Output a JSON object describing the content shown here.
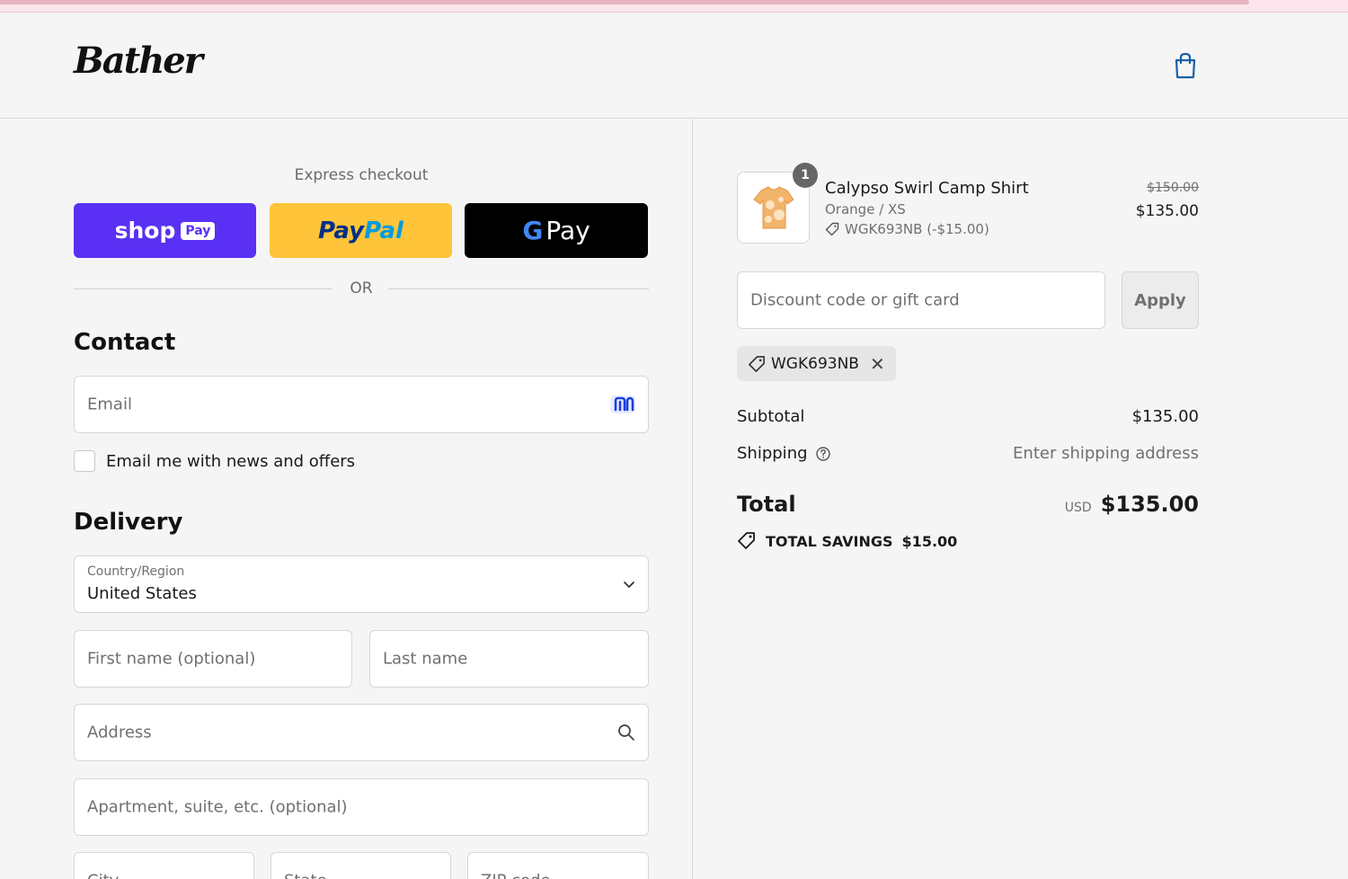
{
  "brand": {
    "logo_text": "Bather"
  },
  "icons": {
    "cart": "shopping-bag-icon",
    "shop_pay_email": "shop-pay-icon",
    "chevron": "chevron-down-icon",
    "search": "search-icon",
    "discount_tag": "tag-icon",
    "remove": "close-icon",
    "help": "question-icon"
  },
  "express": {
    "label": "Express checkout",
    "shop_pay": {
      "text": "shop",
      "badge": "Pay"
    },
    "paypal": {
      "part1": "Pay",
      "part2": "Pal"
    },
    "gpay": {
      "g": "G",
      "text": "Pay"
    },
    "or": "OR"
  },
  "contact": {
    "title": "Contact",
    "email_placeholder": "Email",
    "newsletter_label": "Email me with news and offers"
  },
  "delivery": {
    "title": "Delivery",
    "country_label": "Country/Region",
    "country_value": "United States",
    "first_name_placeholder": "First name (optional)",
    "last_name_placeholder": "Last name",
    "address_placeholder": "Address",
    "apartment_placeholder": "Apartment, suite, etc. (optional)",
    "city_placeholder": "City",
    "state_placeholder": "State",
    "zip_placeholder": "ZIP code"
  },
  "order": {
    "item": {
      "quantity": "1",
      "name": "Calypso Swirl Camp Shirt",
      "variant": "Orange / XS",
      "discount": "WGK693NB (-$15.00)",
      "price_original": "$150.00",
      "price_final": "$135.00"
    },
    "discount_placeholder": "Discount code or gift card",
    "apply_label": "Apply",
    "applied_code": "WGK693NB",
    "subtotal_label": "Subtotal",
    "subtotal_value": "$135.00",
    "shipping_label": "Shipping",
    "shipping_value": "Enter shipping address",
    "total_label": "Total",
    "total_currency": "USD",
    "total_value": "$135.00",
    "savings_label": "TOTAL SAVINGS",
    "savings_value": "$15.00"
  },
  "colors": {
    "shop_pay": "#5a31f4",
    "paypal": "#ffc439",
    "gpay": "#000000"
  }
}
